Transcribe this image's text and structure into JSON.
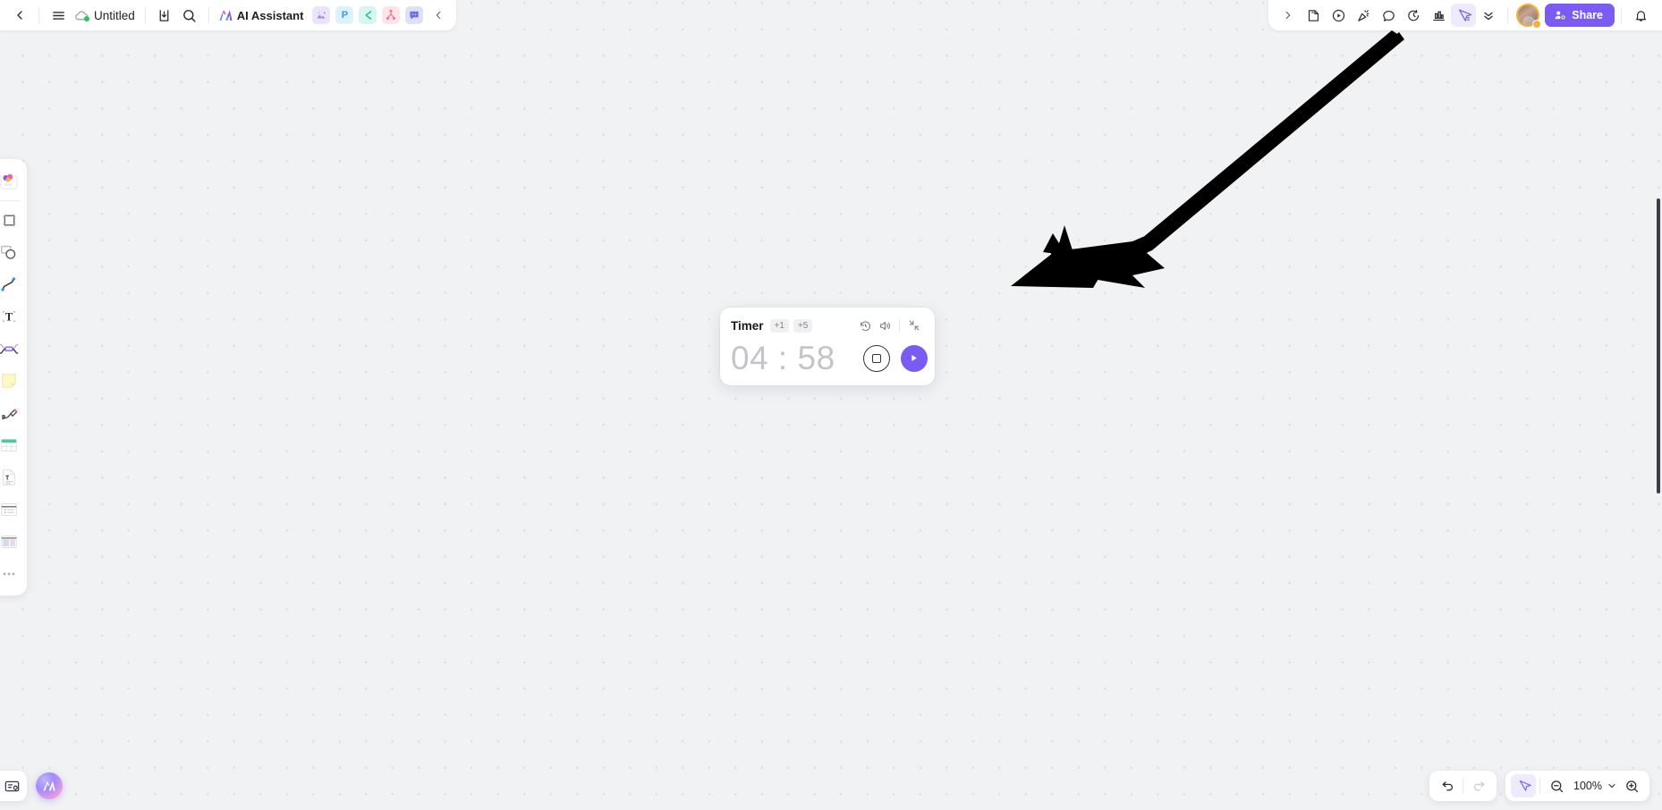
{
  "app": {
    "doc_title": "Untitled",
    "canvas_background": "#f1f2f4",
    "accent_color": "#7a5cf5"
  },
  "topbar_left": {
    "back_icon": "chevron-left-icon",
    "menu_icon": "hamburger-menu-icon",
    "cloud_icon": "cloud-synced-icon",
    "title": "Untitled",
    "download_icon": "download-icon",
    "search_icon": "search-icon",
    "ai_assistant_label": "AI Assistant",
    "app_icons": [
      {
        "name": "image-app-icon",
        "glyph": ""
      },
      {
        "name": "presentation-app-icon",
        "glyph": "P"
      },
      {
        "name": "mindmap-app-icon",
        "glyph": ""
      },
      {
        "name": "flowchart-app-icon",
        "glyph": ""
      },
      {
        "name": "comment-app-icon",
        "glyph": ""
      }
    ],
    "collapse_icon": "chevron-left-icon"
  },
  "topbar_right": {
    "expand_icon": "chevron-right-icon",
    "buttons": [
      {
        "name": "sticky-note-icon"
      },
      {
        "name": "play-circle-icon"
      },
      {
        "name": "celebrate-icon"
      },
      {
        "name": "comment-bubble-icon"
      },
      {
        "name": "timer-icon"
      },
      {
        "name": "chart-icon"
      },
      {
        "name": "cursor-select-icon",
        "active": true
      },
      {
        "name": "chevrons-down-icon"
      }
    ],
    "avatar_name": "user-avatar",
    "share_label": "Share",
    "notification_icon": "bell-icon"
  },
  "sidebar": {
    "items": [
      {
        "name": "sidebar-tool-image",
        "label": "Image"
      },
      {
        "name": "sidebar-tool-frame",
        "label": "Frame"
      },
      {
        "name": "sidebar-tool-shape",
        "label": "Shape"
      },
      {
        "name": "sidebar-tool-connector",
        "label": "Connector"
      },
      {
        "name": "sidebar-tool-text",
        "label": "Text"
      },
      {
        "name": "sidebar-tool-mindmap",
        "label": "Mind map"
      },
      {
        "name": "sidebar-tool-sticky",
        "label": "Sticky note"
      },
      {
        "name": "sidebar-tool-pen",
        "label": "Pen"
      },
      {
        "name": "sidebar-tool-table",
        "label": "Table"
      },
      {
        "name": "sidebar-tool-document",
        "label": "Document"
      },
      {
        "name": "sidebar-tool-list",
        "label": "List"
      },
      {
        "name": "sidebar-tool-slides",
        "label": "Slides"
      },
      {
        "name": "sidebar-tool-more",
        "label": "More"
      }
    ]
  },
  "timer_widget": {
    "title": "Timer",
    "chips": [
      "+1",
      "+5"
    ],
    "reset_icon": "reset-clock-icon",
    "sound_icon": "volume-icon",
    "collapse_icon": "minimize-icon",
    "display": "04 : 58",
    "minutes": "04",
    "seconds": "58",
    "stop_icon": "stop-icon",
    "play_icon": "play-icon"
  },
  "bottom_left": {
    "minimap_icon": "minimap-card-icon",
    "ai_orb_icon": "ai-assistant-orb-icon"
  },
  "bottom_right": {
    "undo_icon": "undo-icon",
    "redo_icon": "redo-icon",
    "select_icon": "cursor-select-icon",
    "zoom_out_icon": "zoom-out-icon",
    "zoom_level": "100%",
    "zoom_chevron_icon": "chevron-down-icon",
    "zoom_in_icon": "zoom-in-icon"
  },
  "annotation": {
    "arrow_name": "pointer-arrow-annotation",
    "arrow_color": "#000000"
  }
}
